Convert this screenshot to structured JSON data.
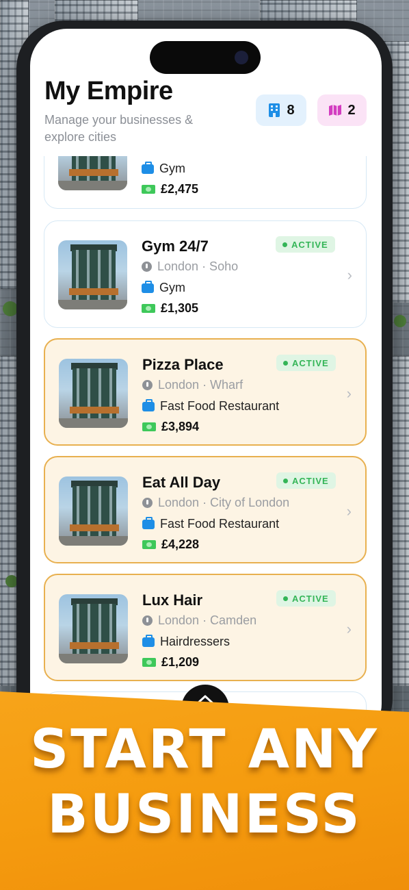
{
  "header": {
    "title": "My Empire",
    "subtitle": "Manage your businesses & explore cities",
    "businesses_count": "8",
    "cities_count": "2"
  },
  "businesses": [
    {
      "name": "",
      "location": "",
      "type": "Gym",
      "income": "£2,475",
      "status": "",
      "tier": "plain"
    },
    {
      "name": "Gym 24/7",
      "location": "London · Soho",
      "type": "Gym",
      "income": "£1,305",
      "status": "ACTIVE",
      "tier": "plain"
    },
    {
      "name": "Pizza Place",
      "location": "London · Wharf",
      "type": "Fast Food Restaurant",
      "income": "£3,894",
      "status": "ACTIVE",
      "tier": "premium"
    },
    {
      "name": "Eat All Day",
      "location": "London · City of London",
      "type": "Fast Food Restaurant",
      "income": "£4,228",
      "status": "ACTIVE",
      "tier": "premium"
    },
    {
      "name": "Lux Hair",
      "location": "London · Camden",
      "type": "Hairdressers",
      "income": "£1,209",
      "status": "ACTIVE",
      "tier": "premium"
    }
  ],
  "banner": {
    "line1": "START ANY",
    "line2": "BUSINESS"
  },
  "colors": {
    "banner_orange": "#f5a015",
    "active_green": "#34b557",
    "premium_border": "#e8b04f",
    "building_chip": "#1e8ee6",
    "map_chip": "#d33cc0"
  },
  "icons": {
    "businesses_chip": "building-icon",
    "cities_chip": "map-icon",
    "location": "pin-icon",
    "type": "briefcase-icon",
    "income": "money-bill-icon",
    "navigate": "chevron-right-icon",
    "home": "home-icon"
  }
}
